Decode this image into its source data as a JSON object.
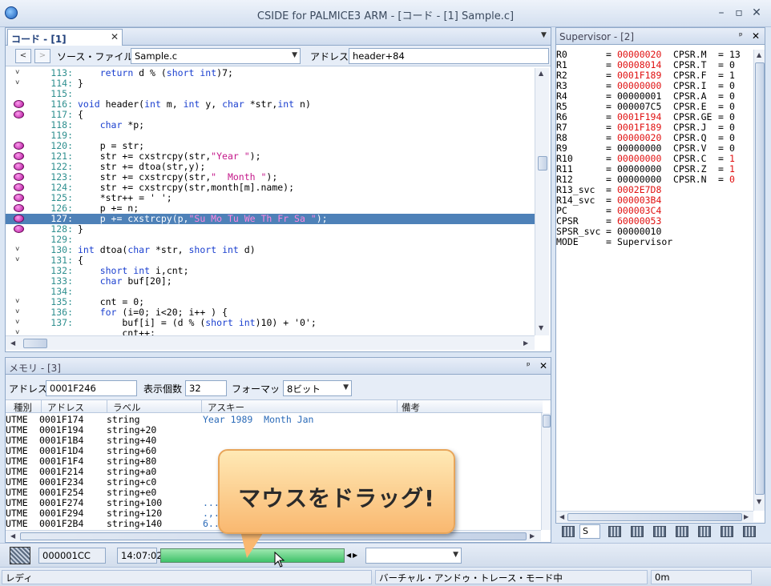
{
  "window": {
    "title": "CSIDE for PALMICE3 ARM - [コード - [1] Sample.c]"
  },
  "code": {
    "tab_label": "コード - [1] Sample.c",
    "source_label": "ソース・ファイル",
    "source_file": "Sample.c",
    "address_label": "アドレス",
    "address_value": "header+84",
    "lines": [
      {
        "n": "113:",
        "text": "    return d % (short int)7;",
        "mk": "ar"
      },
      {
        "n": "114:",
        "text": "}",
        "mk": "ar"
      },
      {
        "n": "115:",
        "text": "",
        "mk": ""
      },
      {
        "n": "116:",
        "text": "void header(int m, int y, char *str,int n)",
        "mk": "bp"
      },
      {
        "n": "117:",
        "text": "{",
        "mk": "bp"
      },
      {
        "n": "118:",
        "text": "    char *p;",
        "mk": ""
      },
      {
        "n": "119:",
        "text": "",
        "mk": ""
      },
      {
        "n": "120:",
        "text": "    p = str;",
        "mk": "bp"
      },
      {
        "n": "121:",
        "text": "    str += cxstrcpy(str,\"Year \");",
        "mk": "bp"
      },
      {
        "n": "122:",
        "text": "    str += dtoa(str,y);",
        "mk": "bp"
      },
      {
        "n": "123:",
        "text": "    str += cxstrcpy(str,\"  Month \");",
        "mk": "bp"
      },
      {
        "n": "124:",
        "text": "    str += cxstrcpy(str,month[m].name);",
        "mk": "bp"
      },
      {
        "n": "125:",
        "text": "    *str++ = ' ';",
        "mk": "bp"
      },
      {
        "n": "126:",
        "text": "    p += n;",
        "mk": "bp"
      },
      {
        "n": "127:",
        "text": "    p += cxstrcpy(p,\"Su Mo Tu We Th Fr Sa \");",
        "mk": "bp",
        "hl": true
      },
      {
        "n": "128:",
        "text": "}",
        "mk": "bp"
      },
      {
        "n": "129:",
        "text": "",
        "mk": ""
      },
      {
        "n": "130:",
        "text": "int dtoa(char *str, short int d)",
        "mk": "ar"
      },
      {
        "n": "131:",
        "text": "{",
        "mk": "ar"
      },
      {
        "n": "132:",
        "text": "    short int i,cnt;",
        "mk": ""
      },
      {
        "n": "133:",
        "text": "    char buf[20];",
        "mk": ""
      },
      {
        "n": "134:",
        "text": "",
        "mk": ""
      },
      {
        "n": "135:",
        "text": "    cnt = 0;",
        "mk": "ar"
      },
      {
        "n": "136:",
        "text": "    for (i=0; i<20; i++ ) {",
        "mk": "ar"
      },
      {
        "n": "137:",
        "text": "        buf[i] = (d % (short int)10) + '0';",
        "mk": "ar"
      },
      {
        "n": "",
        "text": "        cnt++;",
        "mk": "ar"
      }
    ]
  },
  "memory": {
    "title": "メモリ - [3]",
    "address_label": "アドレス",
    "address_value": "0001F246",
    "count_label": "表示個数",
    "count_value": "32",
    "format_label": "フォーマット",
    "format_value": "8ビット",
    "columns": [
      "種別",
      "アドレス",
      "ラベル",
      "アスキー",
      "備考"
    ],
    "rows": [
      {
        "kind": "UTME",
        "addr": "0001F174",
        "label": "string",
        "ascii": "Year 1989  Month Jan"
      },
      {
        "kind": "UTME",
        "addr": "0001F194",
        "label": "string+20",
        "ascii": ""
      },
      {
        "kind": "UTME",
        "addr": "0001F1B4",
        "label": "string+40",
        "ascii": ""
      },
      {
        "kind": "UTME",
        "addr": "0001F1D4",
        "label": "string+60",
        "ascii": ""
      },
      {
        "kind": "UTME",
        "addr": "0001F1F4",
        "label": "string+80",
        "ascii": ""
      },
      {
        "kind": "UTME",
        "addr": "0001F214",
        "label": "string+a0",
        "ascii": ""
      },
      {
        "kind": "UTME",
        "addr": "0001F234",
        "label": "string+c0",
        "ascii": ""
      },
      {
        "kind": "UTME",
        "addr": "0001F254",
        "label": "string+e0",
        "ascii": ""
      },
      {
        "kind": "UTME",
        "addr": "0001F274",
        "label": "string+100",
        "ascii": "..."
      },
      {
        "kind": "UTME",
        "addr": "0001F294",
        "label": "string+120",
        "ascii": ".,."
      },
      {
        "kind": "UTME",
        "addr": "0001F2B4",
        "label": "string+140",
        "ascii": "6..."
      }
    ]
  },
  "supervisor": {
    "title": "Supervisor - [2]",
    "registers": [
      {
        "name": "R0",
        "value": "00000020",
        "changed": true,
        "flag": "CPSR.M",
        "fval": "13",
        "fchanged": false
      },
      {
        "name": "R1",
        "value": "00008014",
        "changed": true,
        "flag": "CPSR.T",
        "fval": "0",
        "fchanged": false
      },
      {
        "name": "R2",
        "value": "0001F189",
        "changed": true,
        "flag": "CPSR.F",
        "fval": "1",
        "fchanged": false
      },
      {
        "name": "R3",
        "value": "00000000",
        "changed": true,
        "flag": "CPSR.I",
        "fval": "0",
        "fchanged": false
      },
      {
        "name": "R4",
        "value": "00000001",
        "changed": false,
        "flag": "CPSR.A",
        "fval": "0",
        "fchanged": false
      },
      {
        "name": "R5",
        "value": "000007C5",
        "changed": false,
        "flag": "CPSR.E",
        "fval": "0",
        "fchanged": false
      },
      {
        "name": "R6",
        "value": "0001F194",
        "changed": true,
        "flag": "CPSR.GE",
        "fval": "0",
        "fchanged": false
      },
      {
        "name": "R7",
        "value": "0001F189",
        "changed": true,
        "flag": "CPSR.J",
        "fval": "0",
        "fchanged": false
      },
      {
        "name": "R8",
        "value": "00000020",
        "changed": true,
        "flag": "CPSR.Q",
        "fval": "0",
        "fchanged": false
      },
      {
        "name": "R9",
        "value": "00000000",
        "changed": false,
        "flag": "CPSR.V",
        "fval": "0",
        "fchanged": false
      },
      {
        "name": "R10",
        "value": "00000000",
        "changed": true,
        "flag": "CPSR.C",
        "fval": "1",
        "fchanged": true
      },
      {
        "name": "R11",
        "value": "00000000",
        "changed": false,
        "flag": "CPSR.Z",
        "fval": "1",
        "fchanged": true
      },
      {
        "name": "R12",
        "value": "00000000",
        "changed": false,
        "flag": "CPSR.N",
        "fval": "0",
        "fchanged": true
      },
      {
        "name": "R13_svc",
        "value": "0002E7D8",
        "changed": true,
        "flag": "",
        "fval": "",
        "fchanged": false
      },
      {
        "name": "R14_svc",
        "value": "000003B4",
        "changed": true,
        "flag": "",
        "fval": "",
        "fchanged": false
      },
      {
        "name": "PC",
        "value": "000003C4",
        "changed": true,
        "flag": "",
        "fval": "",
        "fchanged": false
      },
      {
        "name": "CPSR",
        "value": "60000053",
        "changed": true,
        "flag": "",
        "fval": "",
        "fchanged": false
      },
      {
        "name": "SPSR_svc",
        "value": "00000010",
        "changed": false,
        "flag": "",
        "fval": "",
        "fchanged": false
      },
      {
        "name": "MODE",
        "value": "Supervisor",
        "changed": false,
        "flag": "",
        "fval": "",
        "fchanged": false
      }
    ],
    "tab_label": "S"
  },
  "bottom": {
    "value_field": "000001CC",
    "time": "14:07:02"
  },
  "status": {
    "ready": "レディ",
    "mode": "バーチャル・アンドゥ・トレース・モード中",
    "time": "0m"
  },
  "callout": {
    "text": "マウスをドラッグ!"
  },
  "icons": [
    "app-logo-icon",
    "minimize-icon",
    "maximize-icon",
    "close-icon",
    "breakpoint-icon",
    "arrow-marker-icon",
    "pin-icon",
    "chevron-down-icon",
    "cursor-icon"
  ]
}
